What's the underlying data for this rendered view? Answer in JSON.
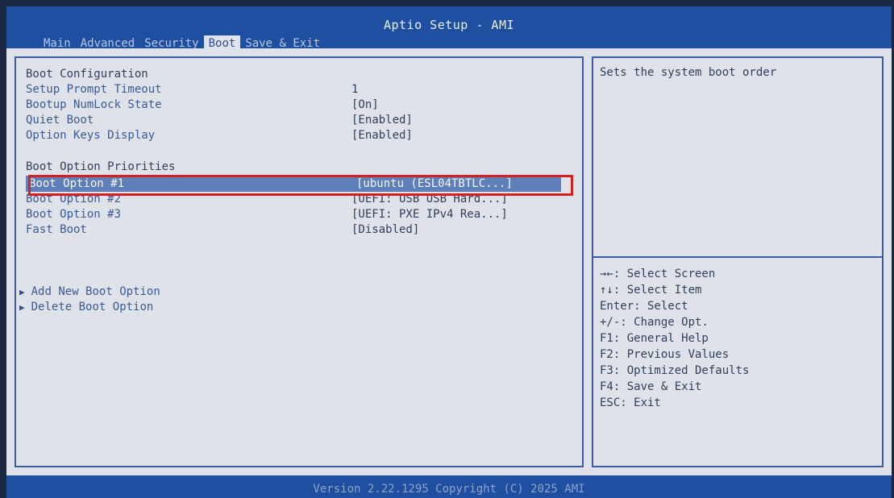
{
  "app": {
    "title": "Aptio Setup - AMI"
  },
  "tabs": [
    {
      "label": "Main"
    },
    {
      "label": "Advanced"
    },
    {
      "label": "Security"
    },
    {
      "label": "Boot"
    },
    {
      "label": "Save & Exit"
    }
  ],
  "active_tab": "Boot",
  "settings": {
    "boot_configuration": "Boot Configuration",
    "setup_prompt_timeout": {
      "label": "Setup Prompt Timeout",
      "value": "1"
    },
    "bootup_numlock_state": {
      "label": "Bootup NumLock State",
      "value": "[On]"
    },
    "quiet_boot": {
      "label": "Quiet Boot",
      "value": "[Enabled]"
    },
    "option_keys_display": {
      "label": "Option Keys Display",
      "value": "[Enabled]"
    },
    "boot_option_priorities": "Boot Option Priorities",
    "boot_option_1": {
      "label": "Boot Option #1",
      "value": "[ubuntu (ESL04TBTLC...]"
    },
    "boot_option_2": {
      "label": "Boot Option #2",
      "value": "[UEFI: USB USB Hard...]"
    },
    "boot_option_3": {
      "label": "Boot Option #3",
      "value": "[UEFI: PXE IPv4 Rea...]"
    },
    "fast_boot": {
      "label": "Fast Boot",
      "value": "[Disabled]"
    }
  },
  "submenus": [
    {
      "label": "Add New Boot Option"
    },
    {
      "label": "Delete Boot Option"
    }
  ],
  "help": {
    "text": "Sets the system boot order"
  },
  "key_help": [
    "→←: Select Screen",
    "↑↓: Select Item",
    "Enter: Select",
    "+/-: Change Opt.",
    "F1: General Help",
    "F2: Previous Values",
    "F3: Optimized Defaults",
    "F4: Save & Exit",
    "ESC: Exit"
  ],
  "footer": {
    "version": "Version 2.22.1295 Copyright (C) 2025 AMI"
  }
}
